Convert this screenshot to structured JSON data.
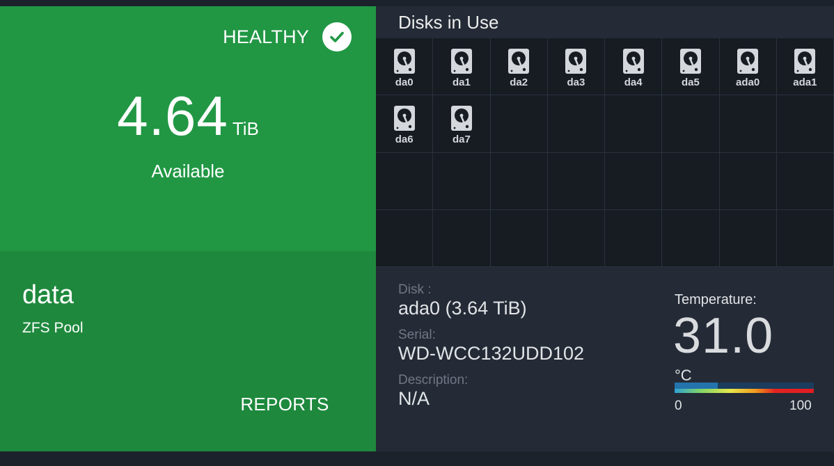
{
  "pool": {
    "status": "HEALTHY",
    "available_value": "4.64",
    "available_unit": "TiB",
    "available_label": "Available",
    "name": "data",
    "type": "ZFS Pool",
    "reports_label": "REPORTS",
    "status_color": "#219744"
  },
  "disks_panel": {
    "title": "Disks in Use",
    "disks": [
      "da0",
      "da1",
      "da2",
      "da3",
      "da4",
      "da5",
      "ada0",
      "ada1",
      "da6",
      "da7"
    ]
  },
  "disk_details": {
    "disk_label": "Disk :",
    "disk_value": "ada0 (3.64 TiB)",
    "serial_label": "Serial:",
    "serial_value": "WD-WCC132UDD102",
    "description_label": "Description:",
    "description_value": "N/A"
  },
  "temperature": {
    "label": "Temperature:",
    "value": "31.0",
    "unit": "°C",
    "min": "0",
    "max": "100",
    "level_fraction": 0.31
  },
  "icons": {
    "status": "check-circle-icon",
    "disk": "hard-disk-icon"
  }
}
